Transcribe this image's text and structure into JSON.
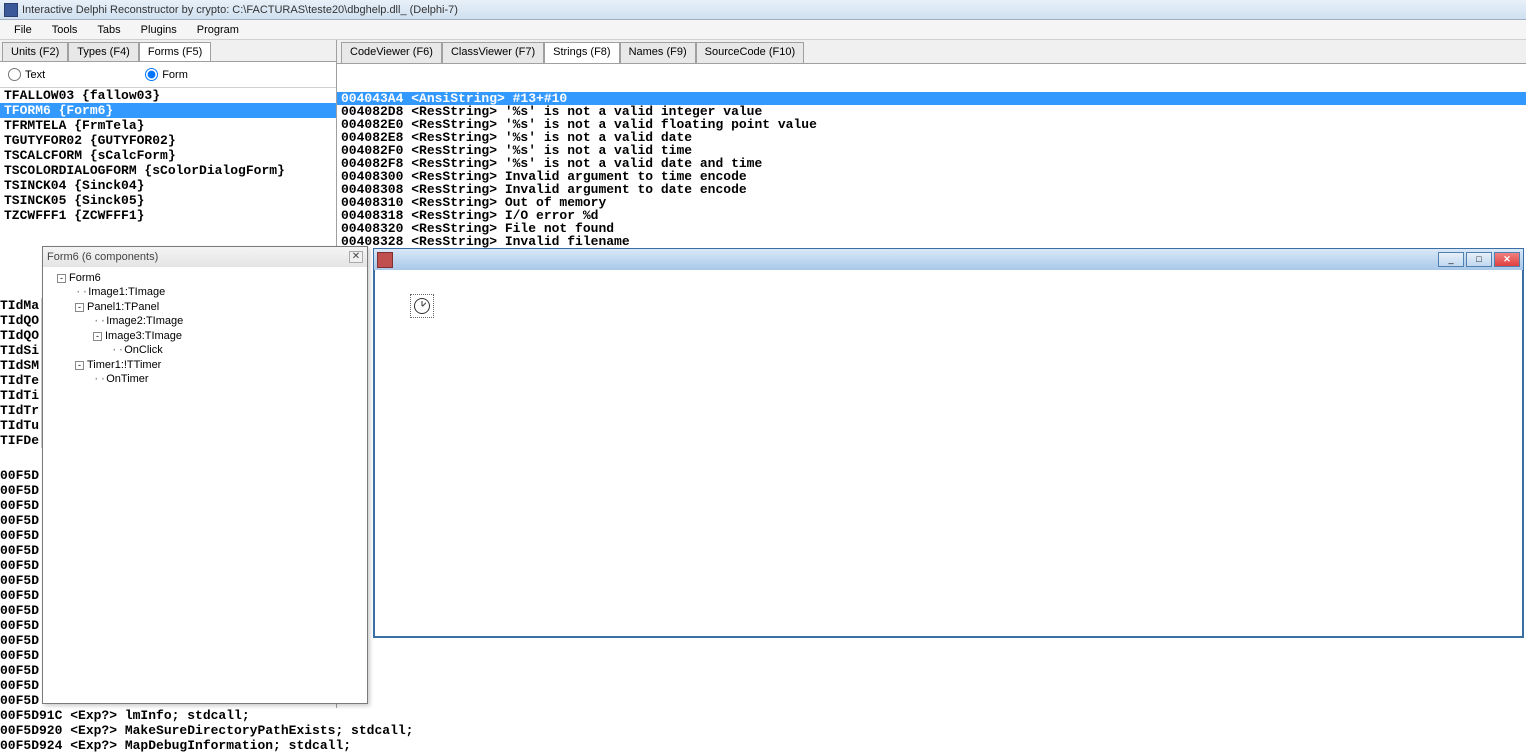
{
  "title": "Interactive Delphi Reconstructor by crypto: C:\\FACTURAS\\teste20\\dbghelp.dll_ (Delphi-7)",
  "menu": [
    "File",
    "Tools",
    "Tabs",
    "Plugins",
    "Program"
  ],
  "left_tabs": [
    {
      "label": "Units (F2)",
      "active": false
    },
    {
      "label": "Types (F4)",
      "active": false
    },
    {
      "label": "Forms (F5)",
      "active": true
    }
  ],
  "radio": {
    "text_label": "Text",
    "form_label": "Form"
  },
  "forms": [
    {
      "text": "TFALLOW03 {fallow03}",
      "selected": false
    },
    {
      "text": "TFORM6 {Form6}",
      "selected": true
    },
    {
      "text": "TFRMTELA {FrmTela}",
      "selected": false
    },
    {
      "text": "TGUTYFOR02 {GUTYFOR02}",
      "selected": false
    },
    {
      "text": "TSCALCFORM {sCalcForm}",
      "selected": false
    },
    {
      "text": "TSCOLORDIALOGFORM {sColorDialogForm}",
      "selected": false
    },
    {
      "text": "TSINCK04 {Sinck04}",
      "selected": false
    },
    {
      "text": "TSINCK05 {Sinck05}",
      "selected": false
    },
    {
      "text": "TZCWFFF1 {ZCWFFF1}",
      "selected": false
    }
  ],
  "right_tabs": [
    {
      "label": "CodeViewer (F6)",
      "active": false
    },
    {
      "label": "ClassViewer (F7)",
      "active": false
    },
    {
      "label": "Strings (F8)",
      "active": true
    },
    {
      "label": "Names (F9)",
      "active": false
    },
    {
      "label": "SourceCode (F10)",
      "active": false
    }
  ],
  "strings": [
    {
      "text": "004043A4 <AnsiString> #13+#10",
      "selected": true
    },
    {
      "text": "004082D8 <ResString> '%s' is not a valid integer value",
      "selected": false
    },
    {
      "text": "004082E0 <ResString> '%s' is not a valid floating point value",
      "selected": false
    },
    {
      "text": "004082E8 <ResString> '%s' is not a valid date",
      "selected": false
    },
    {
      "text": "004082F0 <ResString> '%s' is not a valid time",
      "selected": false
    },
    {
      "text": "004082F8 <ResString> '%s' is not a valid date and time",
      "selected": false
    },
    {
      "text": "00408300 <ResString> Invalid argument to time encode",
      "selected": false
    },
    {
      "text": "00408308 <ResString> Invalid argument to date encode",
      "selected": false
    },
    {
      "text": "00408310 <ResString> Out of memory",
      "selected": false
    },
    {
      "text": "00408318 <ResString> I/O error %d",
      "selected": false
    },
    {
      "text": "00408320 <ResString> File not found",
      "selected": false
    },
    {
      "text": "00408328 <ResString> Invalid filename",
      "selected": false
    }
  ],
  "left_stub": [
    "TIdMa",
    "TIdQO",
    "TIdQO",
    "TIdSi",
    "TIdSM",
    "TIdTe",
    "TIdTi",
    "TIdTr",
    "TIdTu",
    "TIFDe"
  ],
  "bottom_addrs": [
    "00F5D",
    "00F5D",
    "00F5D",
    "00F5D",
    "00F5D",
    "00F5D",
    "00F5D",
    "00F5D",
    "00F5D",
    "00F5D",
    "00F5D",
    "00F5D",
    "00F5D",
    "00F5D",
    "00F5D",
    "00F5D"
  ],
  "bottom_code": [
    "00F5D91C <Exp?> lmInfo; stdcall;",
    "00F5D920 <Exp?> MakeSureDirectoryPathExists; stdcall;",
    "00F5D924 <Exp?> MapDebugInformation; stdcall;"
  ],
  "tree": {
    "title": "Form6 (6 components)",
    "nodes": [
      {
        "indent": 0,
        "exp": "-",
        "label": "Form6"
      },
      {
        "indent": 1,
        "exp": "",
        "label": "Image1:TImage"
      },
      {
        "indent": 1,
        "exp": "-",
        "label": "Panel1:TPanel"
      },
      {
        "indent": 2,
        "exp": "",
        "label": "Image2:TImage"
      },
      {
        "indent": 2,
        "exp": "-",
        "label": "Image3:TImage"
      },
      {
        "indent": 3,
        "exp": "",
        "label": "OnClick"
      },
      {
        "indent": 1,
        "exp": "-",
        "label": "Timer1:!TTimer"
      },
      {
        "indent": 2,
        "exp": "",
        "label": "OnTimer"
      }
    ]
  }
}
